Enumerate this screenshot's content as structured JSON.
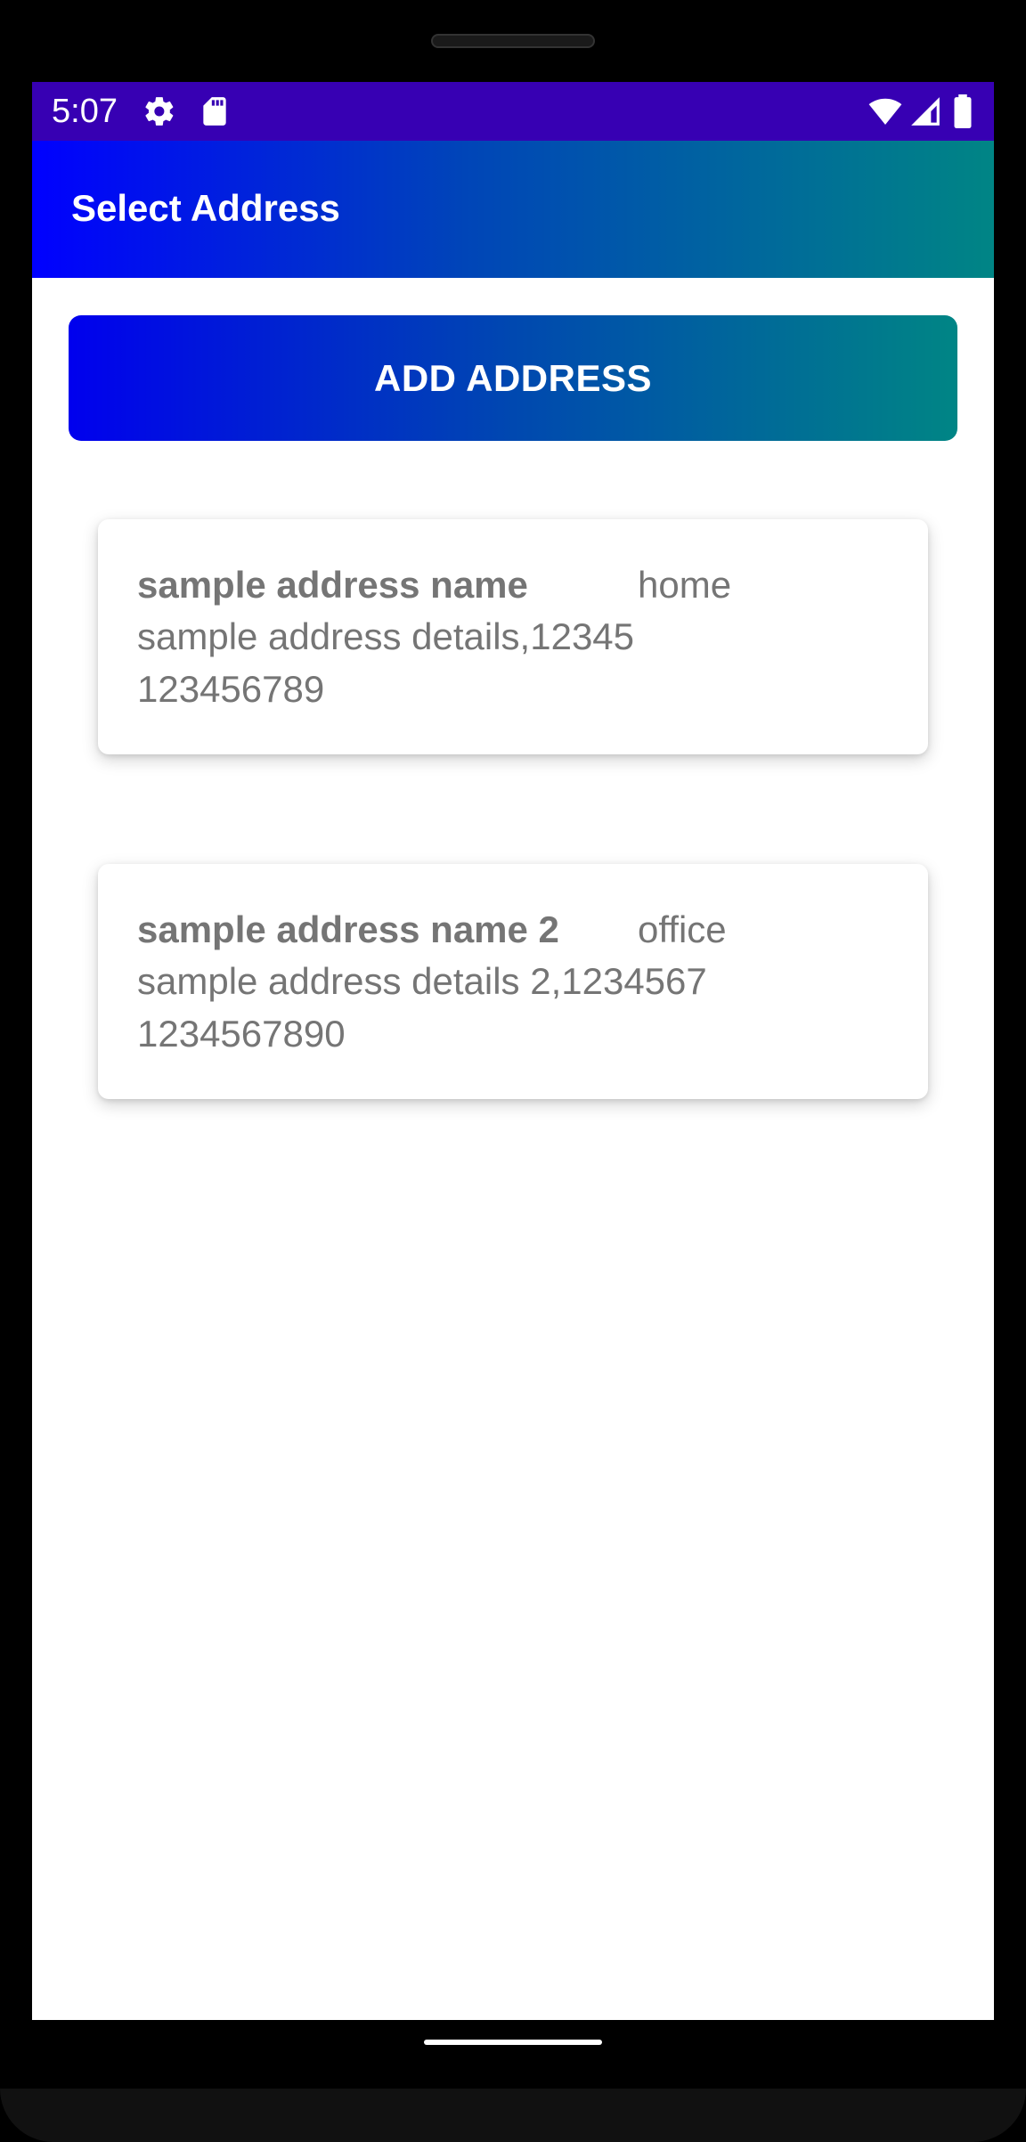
{
  "status_bar": {
    "time": "5:07",
    "left_icons": [
      "gear-icon",
      "sd-card-icon"
    ],
    "right_icons": [
      "wifi-icon",
      "signal-icon",
      "battery-icon"
    ],
    "color": "#3700b3"
  },
  "app_bar": {
    "title": "Select Address",
    "gradient": [
      "#0000ff",
      "#008585"
    ]
  },
  "add_button": {
    "label": "ADD ADDRESS"
  },
  "addresses": [
    {
      "name": "sample address name",
      "type": "home",
      "details": "sample address details,12345",
      "phone": "123456789"
    },
    {
      "name": "sample address name 2",
      "type": "office",
      "details": "sample address details 2,1234567",
      "phone": "1234567890"
    }
  ],
  "colors": {
    "card_text": "#757575",
    "background": "#ffffff"
  }
}
